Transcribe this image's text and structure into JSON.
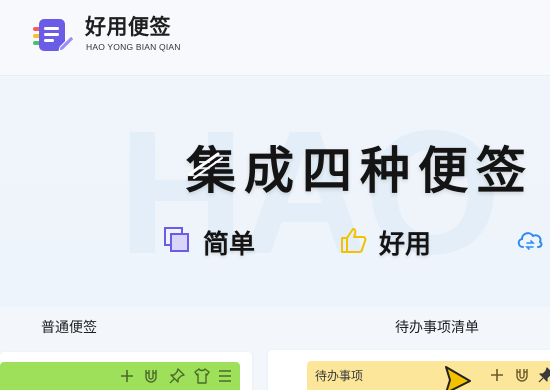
{
  "header": {
    "brand_name": "好用便签",
    "brand_sub": "HAO YONG BIAN QIAN",
    "logo_icon": "note-logo-icon"
  },
  "hero": {
    "watermark": "HAO",
    "title": "集成四种便签",
    "features": [
      {
        "icon": "square-stack-icon",
        "label": "简单"
      },
      {
        "icon": "thumbs-up-icon",
        "label": "好用"
      },
      {
        "icon": "cloud-sync-icon",
        "label": ""
      }
    ]
  },
  "sections": {
    "normal_label": "普通便签",
    "todo_label": "待办事项清单"
  },
  "notes": {
    "green_note": {
      "color": "#9fe05a",
      "icons": [
        "plus-icon",
        "magnet-icon",
        "pin-icon",
        "shirt-icon",
        "menu-icon"
      ]
    },
    "yellow_note": {
      "title": "待办事项",
      "color": "#fbe69a",
      "icons": [
        "plus-icon",
        "magnet-icon",
        "pin-icon"
      ]
    }
  },
  "colors": {
    "accent_purple": "#6b5ce7",
    "accent_yellow": "#f2c200",
    "accent_blue": "#2d8cf0"
  }
}
